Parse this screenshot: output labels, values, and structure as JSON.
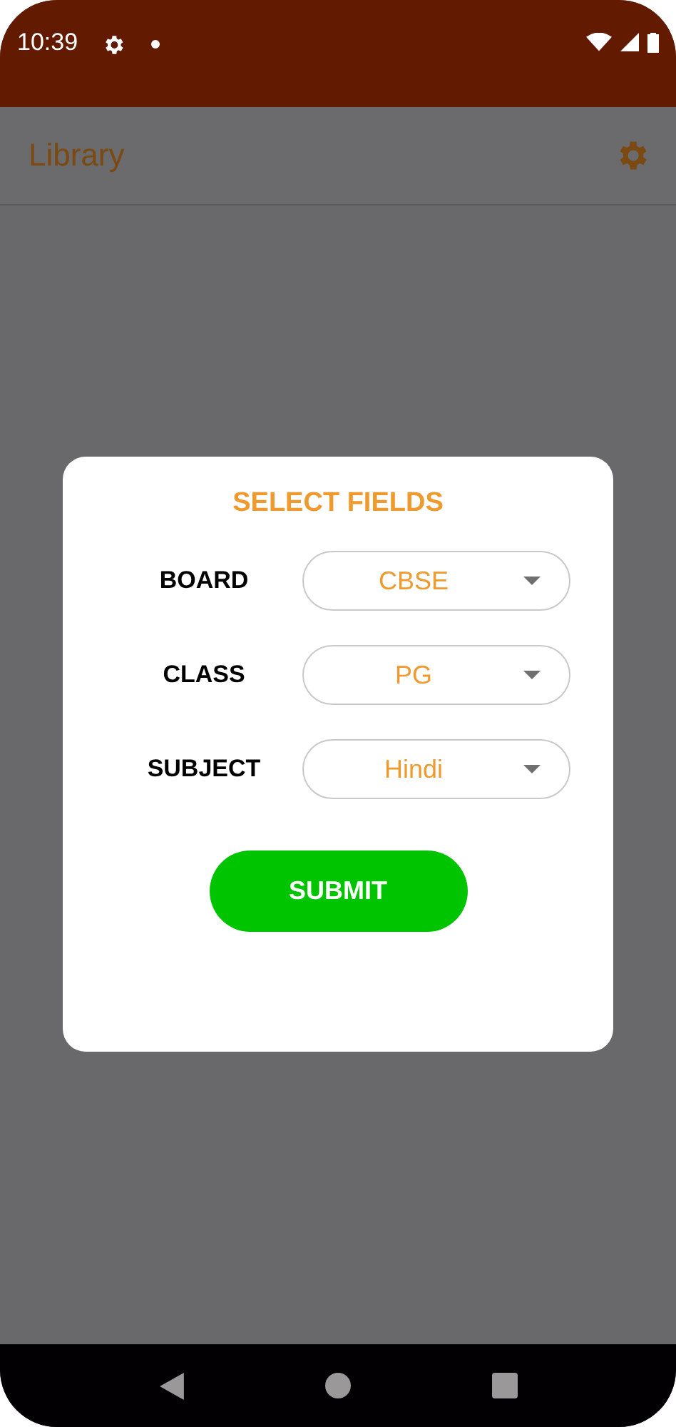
{
  "status_bar": {
    "time": "10:39"
  },
  "app_bar": {
    "title": "Library"
  },
  "dialog": {
    "title": "SELECT FIELDS",
    "fields": [
      {
        "label": "BOARD",
        "value": "CBSE"
      },
      {
        "label": "CLASS",
        "value": "PG"
      },
      {
        "label": "SUBJECT",
        "value": "Hindi"
      }
    ],
    "submit": "SUBMIT"
  }
}
